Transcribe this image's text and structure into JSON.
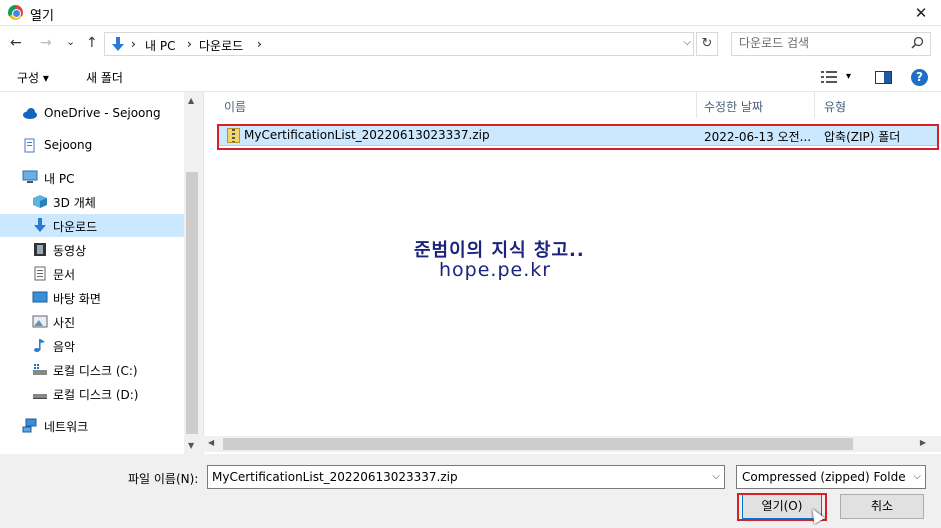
{
  "window": {
    "title": "열기",
    "close_label": "✕"
  },
  "nav_buttons": {
    "back": "←",
    "forward": "→",
    "recent": "⌄",
    "up": "↑"
  },
  "address": {
    "crumbs": [
      "내 PC",
      "다운로드"
    ],
    "separator": "›",
    "dropdown": "⌵",
    "refresh": "↻"
  },
  "search": {
    "placeholder": "다운로드 검색",
    "icon": "search-icon"
  },
  "toolbar": {
    "organize": "구성 ▾",
    "new_folder": "새 폴더",
    "view_dd": "▾",
    "help": "?"
  },
  "sidebar": {
    "items": [
      {
        "label": "OneDrive - Sejoong",
        "icon": "cloud-icon"
      },
      {
        "label": "Sejoong",
        "icon": "user-icon"
      },
      {
        "label": "내 PC",
        "icon": "pc-icon"
      },
      {
        "label": "3D 개체",
        "icon": "cube-icon"
      },
      {
        "label": "다운로드",
        "icon": "download-icon",
        "selected": true
      },
      {
        "label": "동영상",
        "icon": "film-icon"
      },
      {
        "label": "문서",
        "icon": "document-icon"
      },
      {
        "label": "바탕 화면",
        "icon": "desktop-icon"
      },
      {
        "label": "사진",
        "icon": "picture-icon"
      },
      {
        "label": "음악",
        "icon": "music-icon"
      },
      {
        "label": "로컬 디스크 (C:)",
        "icon": "drive-icon"
      },
      {
        "label": "로컬 디스크 (D:)",
        "icon": "drive-icon"
      },
      {
        "label": "네트워크",
        "icon": "network-icon"
      }
    ]
  },
  "columns": {
    "name": "이름",
    "date": "수정한 날짜",
    "type": "유형"
  },
  "files": [
    {
      "name": "MyCertificationList_20220613023337.zip",
      "date": "2022-06-13 오전...",
      "type": "압축(ZIP) 폴더",
      "icon": "zip-folder-icon"
    }
  ],
  "watermark": {
    "line1": "준범이의 지식 창고..",
    "line2": "hope.pe.kr"
  },
  "footer": {
    "filename_label": "파일 이름(N):",
    "filename_value": "MyCertificationList_20220613023337.zip",
    "filetype_value": "Compressed (zipped) Folder (*",
    "open_label": "열기(O)",
    "cancel_label": "취소"
  },
  "colors": {
    "selection": "#cce8ff",
    "highlight_box": "#d8202a",
    "accent": "#0078d7"
  }
}
